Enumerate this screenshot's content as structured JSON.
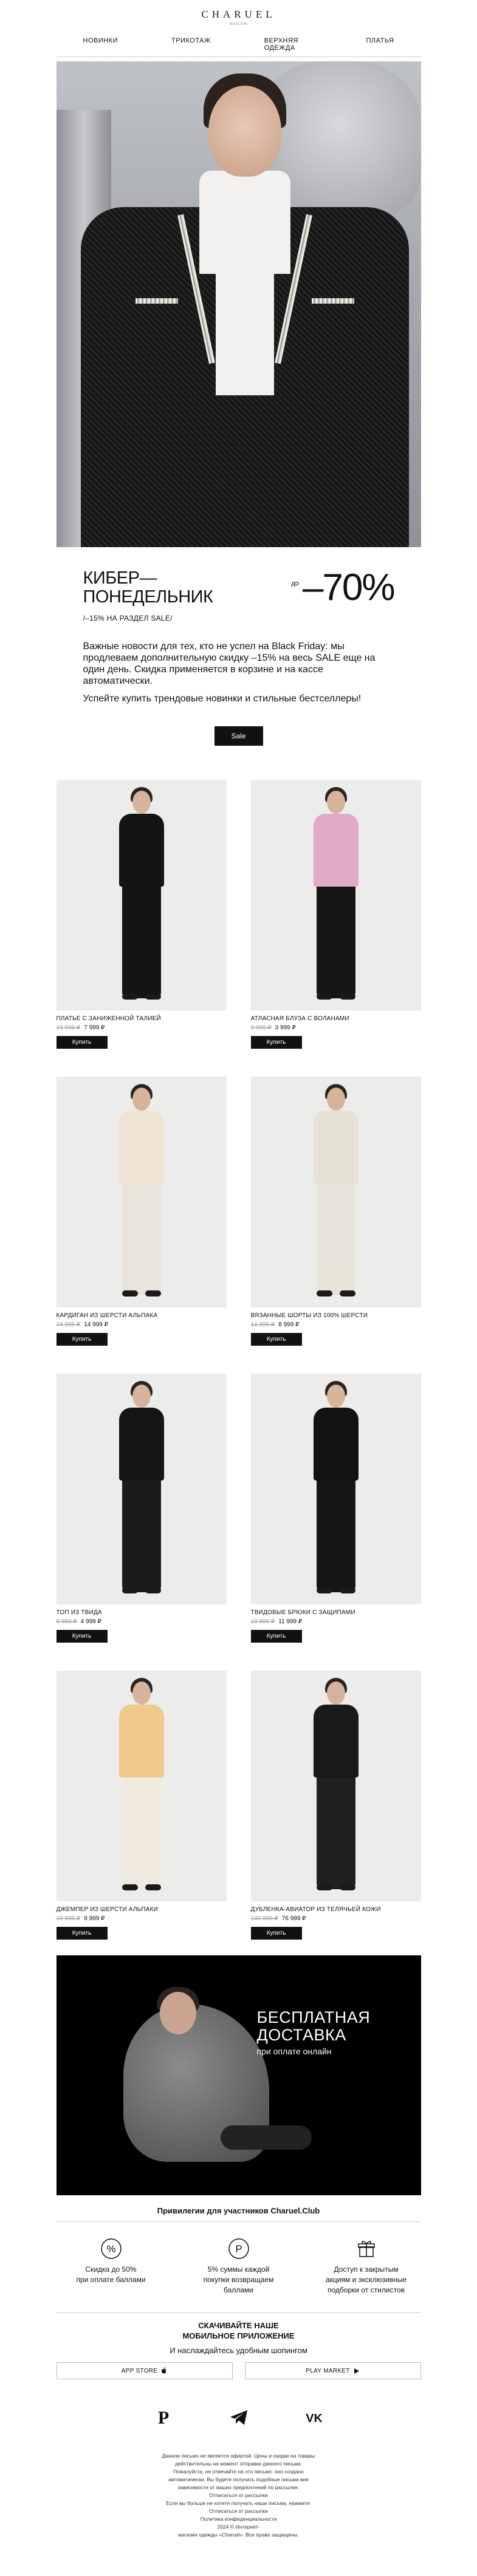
{
  "header": {
    "brand": "CHARUEL",
    "brand_sub": "MOSCOW",
    "nav": [
      "НОВИНКИ",
      "ТРИКОТАЖ",
      "ВЕРХНЯЯ ОДЕЖДА",
      "ПЛАТЬЯ"
    ]
  },
  "promo": {
    "title_line1": "КИБЕР—",
    "title_line2": "ПОНЕДЕЛЬНИК",
    "prefix": "до",
    "discount": "–70%",
    "subtitle": "/–15% НА РАЗДЕЛ SALE/",
    "text1": "Важные новости для тех, кто не успел на Black Friday: мы продлеваем дополнительную скидку –15% на весь SALE еще на один день. Скидка применяется в корзине и на кассе автоматически.",
    "text2": "Успейте купить трендовые новинки и стильные бестселлеры!",
    "button": "Sale"
  },
  "products": [
    {
      "name": "ПЛАТЬЕ С ЗАНИЖЕННОЙ ТАЛИЕЙ",
      "old_price": "19 999 ₽",
      "price": "7 999 ₽",
      "button": "Купить",
      "top_color": "#141414",
      "bottom_color": "#141414"
    },
    {
      "name": "АТЛАСНАЯ БЛУЗА С ВОЛАНАМИ",
      "old_price": "9 999 ₽",
      "price": "3 999 ₽",
      "button": "Купить",
      "top_color": "#e3a9c8",
      "bottom_color": "#151515"
    },
    {
      "name": "КАРДИГАН ИЗ ШЕРСТИ АЛЬПАКА",
      "old_price": "24 999 ₽",
      "price": "14 999 ₽",
      "button": "Купить",
      "top_color": "#efe3d6",
      "bottom_color": "#e9e4dc"
    },
    {
      "name": "ВЯЗАННЫЕ ШОРТЫ ИЗ 100% ШЕРСТИ",
      "old_price": "14 999 ₽",
      "price": "8 999 ₽",
      "button": "Купить",
      "top_color": "#e6e1d5",
      "bottom_color": "#e8e3d8"
    },
    {
      "name": "ТОП ИЗ ТВИДА",
      "old_price": "9 999 ₽",
      "price": "4 999 ₽",
      "button": "Купить",
      "top_color": "#151515",
      "bottom_color": "#1b1b1b"
    },
    {
      "name": "ТВИДОВЫЕ БРЮКИ С ЗАЩИПАМИ",
      "old_price": "19 999 ₽",
      "price": "11 999 ₽",
      "button": "Купить",
      "top_color": "#121212",
      "bottom_color": "#161616"
    },
    {
      "name": "ДЖЕМПЕР ИЗ ШЕРСТИ АЛЬПАКИ",
      "old_price": "19 999 ₽",
      "price": "9 999 ₽",
      "button": "Купить",
      "top_color": "#f1c98c",
      "bottom_color": "#efe9de"
    },
    {
      "name": "ДУБЛЕНКА-АВИАТОР ИЗ ТЕЛЯЧЬЕЙ КОЖИ",
      "old_price": "149 999 ₽",
      "price": "76 999 ₽",
      "button": "Купить",
      "top_color": "#1a1a1a",
      "bottom_color": "#1f1f1f"
    }
  ],
  "delivery": {
    "title_line1": "БЕСПЛАТНАЯ",
    "title_line2": "ДОСТАВКА",
    "subtitle": "при оплате онлайн"
  },
  "club": {
    "title": "Привилегии для участников Charuel.Club",
    "perks": [
      {
        "icon": "percent-icon",
        "line1": "Скидка до 50%",
        "line2": "при оплате баллами"
      },
      {
        "icon": "points-icon",
        "line1": "5% суммы каждой",
        "line2": "покупки возвращаем",
        "line3": "баллами"
      },
      {
        "icon": "gift-icon",
        "line1": "Доступ к закрытым",
        "line2": "акциям и эксклюзивные",
        "line3": "подборки от стилистов"
      }
    ]
  },
  "app": {
    "title_line1": "СКАЧИВАЙТЕ НАШЕ",
    "title_line2": "МОБИЛЬНОЕ ПРИЛОЖЕНИЕ",
    "subtitle": "И наслаждайтесь удобным шопингом",
    "app_store": "APP STORE",
    "play_market": "PLAY MARKET"
  },
  "socials": [
    "pinterest-icon",
    "telegram-icon",
    "vk-icon"
  ],
  "footer": {
    "lines": [
      "Данное письмо не является офертой. Цены и скидки на товары",
      "действительны на момент отправки данного письма.",
      "Пожалуйста, не отвечайте на это письмо: оно создано",
      "автоматически. Вы будете получать подобные письма вне",
      "зависимости от ваших предпочтений по рассылке.",
      "Отписаться от рассылки",
      "Если вы больше не хотите получать наши письма, нажмите:",
      "Отписаться от рассылки",
      "Политика конфиденциальности",
      "2024 © Интернет-",
      "магазин одежды «Charuel». Все права защищены."
    ]
  }
}
